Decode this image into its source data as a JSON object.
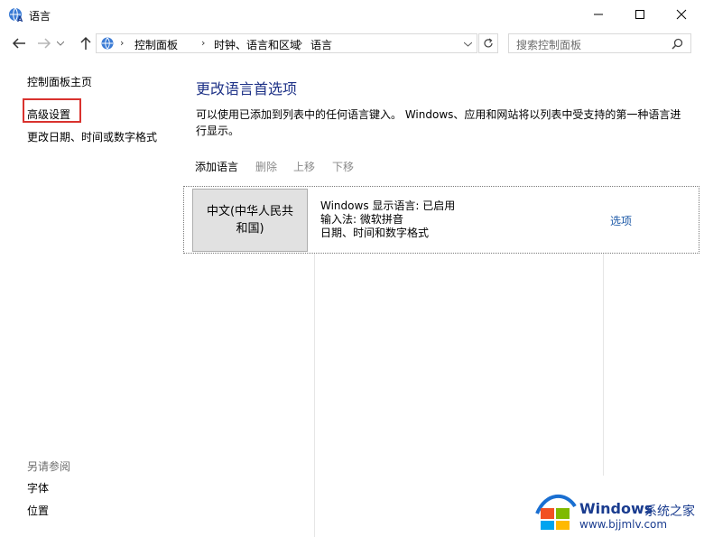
{
  "window": {
    "title": "语言",
    "minimize_label": "─",
    "maximize_label": "☐",
    "close_label": "✕"
  },
  "breadcrumb": [
    {
      "label": "控制面板"
    },
    {
      "label": "时钟、语言和区域"
    },
    {
      "label": "语言"
    }
  ],
  "search": {
    "placeholder": "搜索控制面板"
  },
  "sidebar": {
    "home": "控制面板主页",
    "advanced": "高级设置",
    "change_date_format": "更改日期、时间或数字格式",
    "see_also_header": "另请参阅",
    "fonts": "字体",
    "location": "位置"
  },
  "main": {
    "title": "更改语言首选项",
    "description": "可以使用已添加到列表中的任何语言键入。 Windows、应用和网站将以列表中受支持的第一种语言进行显示。",
    "toolbar": {
      "add": "添加语言",
      "remove": "删除",
      "move_up": "上移",
      "move_down": "下移"
    },
    "languages": [
      {
        "name_line1": "中文(中华人民共",
        "name_line2": "和国)",
        "display_language": "Windows 显示语言: 已启用",
        "input_method": "输入法: 微软拼音",
        "date_format": "日期、时间和数字格式",
        "options": "选项"
      }
    ]
  },
  "watermark": {
    "brand": "Windows",
    "cn": "系统之家",
    "url": "www.bjjmlv.com"
  },
  "colors": {
    "accent_title": "#1e3287",
    "link": "#1e5aa8",
    "highlight": "#d9322e",
    "disabled": "#8a8a8a"
  }
}
